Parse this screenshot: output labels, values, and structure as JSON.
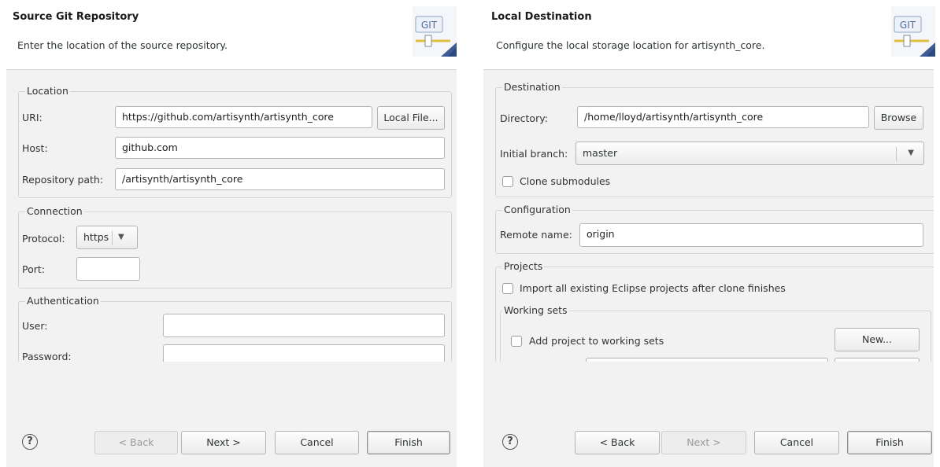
{
  "left": {
    "banner": {
      "title": "Source Git Repository",
      "description": "Enter the location of the source repository.",
      "logo": "GIT"
    },
    "location": {
      "title": "Location",
      "uri_label": "URI:",
      "uri_value": "https://github.com/artisynth/artisynth_core",
      "local_file_button": "Local File...",
      "host_label": "Host:",
      "host_value": "github.com",
      "path_label": "Repository path:",
      "path_value": "/artisynth/artisynth_core"
    },
    "connection": {
      "title": "Connection",
      "protocol_label": "Protocol:",
      "protocol_value": "https",
      "port_label": "Port:",
      "port_value": ""
    },
    "authentication": {
      "title": "Authentication",
      "user_label": "User:",
      "user_value": "",
      "password_label": "Password:"
    },
    "footer": {
      "help": "?",
      "back": "< Back",
      "next": "Next >",
      "cancel": "Cancel",
      "finish": "Finish"
    }
  },
  "right": {
    "banner": {
      "title": "Local Destination",
      "description": "Configure the local storage location for artisynth_core.",
      "logo": "GIT"
    },
    "destination": {
      "title": "Destination",
      "directory_label": "Directory:",
      "directory_value": "/home/lloyd/artisynth/artisynth_core",
      "browse_button": "Browse",
      "branch_label": "Initial branch:",
      "branch_value": "master",
      "clone_submodules": "Clone submodules"
    },
    "configuration": {
      "title": "Configuration",
      "remote_label": "Remote name:",
      "remote_value": "origin"
    },
    "projects": {
      "title": "Projects",
      "import_label": "Import all existing Eclipse projects after clone finishes",
      "working_sets_title": "Working sets",
      "add_to_working_sets": "Add project to working sets",
      "new_button": "New..."
    },
    "footer": {
      "help": "?",
      "back": "< Back",
      "next": "Next >",
      "cancel": "Cancel",
      "finish": "Finish"
    }
  }
}
